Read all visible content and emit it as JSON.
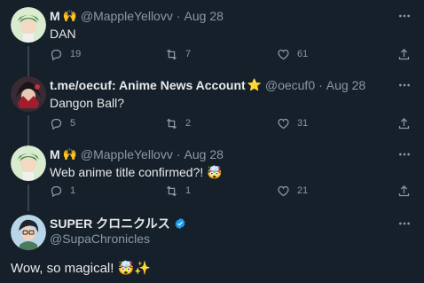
{
  "tweets": [
    {
      "name": "M",
      "name_emoji": "🙌",
      "handle": "@MappleYellovv",
      "time": "Aug 28",
      "text": "DAN",
      "replies": "19",
      "retweets": "7",
      "likes": "61"
    },
    {
      "name": "t.me/oecuf: Anime News Account",
      "name_emoji": "⭐",
      "handle": "@oecuf0",
      "time": "Aug 28",
      "text": "Dangon Ball?",
      "replies": "5",
      "retweets": "2",
      "likes": "31"
    },
    {
      "name": "M",
      "name_emoji": "🙌",
      "handle": "@MappleYellovv",
      "time": "Aug 28",
      "text": "Web anime title confirmed?! 🤯",
      "replies": "1",
      "retweets": "1",
      "likes": "21"
    }
  ],
  "main": {
    "name": "SUPER クロニクルス",
    "handle": "@SupaChronicles",
    "text": "Wow, so magical! 🤯✨"
  },
  "separator": "·",
  "icons": {
    "reply": "reply-icon",
    "retweet": "retweet-icon",
    "like": "like-icon",
    "share": "share-icon",
    "more": "more-icon",
    "verified": "verified-badge-icon"
  },
  "colors": {
    "background": "#15202b",
    "text": "#e7e9ea",
    "muted": "#8b98a5",
    "thread_line": "#38444d",
    "verified": "#1d9bf0"
  }
}
